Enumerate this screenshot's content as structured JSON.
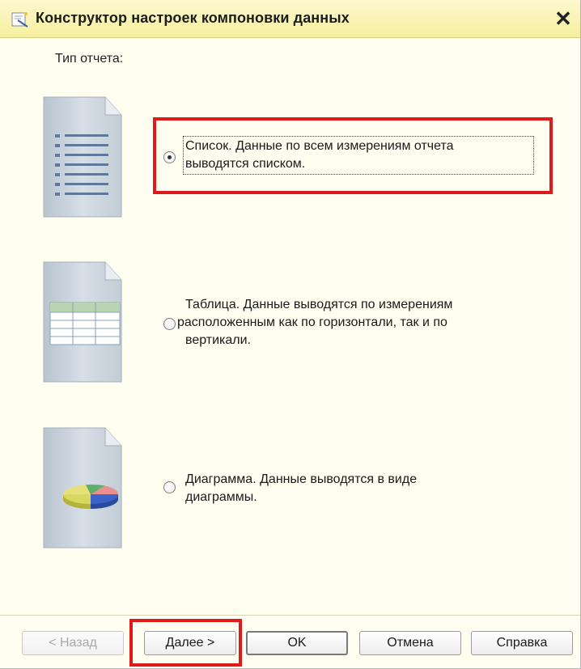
{
  "window": {
    "title": "Конструктор настроек компоновки данных",
    "close_glyph": "✕"
  },
  "report_type_label": "Тип отчета:",
  "options": [
    {
      "id": "list",
      "icon": "list-document-icon",
      "text_line1": "Список. Данные по всем измерениям отчета",
      "text_line2": "выводятся списком.",
      "selected": true
    },
    {
      "id": "table",
      "icon": "table-document-icon",
      "text_line1": "Таблица. Данные выводятся по измерениям",
      "text_line2": "расположенным как по горизонтали, так и по",
      "text_line3": "вертикали.",
      "selected": false
    },
    {
      "id": "chart",
      "icon": "chart-document-icon",
      "text_line1": "Диаграмма. Данные выводятся в виде",
      "text_line2": "диаграммы.",
      "selected": false
    }
  ],
  "buttons": {
    "back": "< Назад",
    "next": "Далее >",
    "ok": "OK",
    "cancel": "Отмена",
    "help": "Справка"
  },
  "colors": {
    "highlight": "#e01a1a",
    "title_bar": "#f6ef9e",
    "background": "#fffef0"
  }
}
